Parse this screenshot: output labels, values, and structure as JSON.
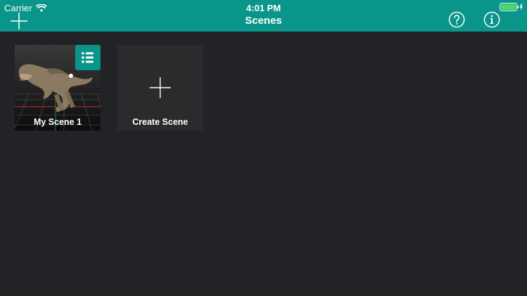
{
  "status_bar": {
    "carrier": "Carrier",
    "time": "4:01 PM",
    "battery_icon": "battery-charging-icon"
  },
  "header": {
    "title": "Scenes",
    "left_icon": "add-icon",
    "right_icons": [
      "help-icon",
      "info-icon"
    ]
  },
  "scenes": [
    {
      "label": "My Scene 1",
      "thumbnail": "t-rex-3d-model-on-grid",
      "menu_icon": "list-icon"
    }
  ],
  "create_card": {
    "label": "Create Scene",
    "icon": "plus-icon"
  },
  "colors": {
    "accent": "#0a958a",
    "background": "#222326",
    "card_background": "#2b2b2d",
    "text": "#ffffff"
  }
}
